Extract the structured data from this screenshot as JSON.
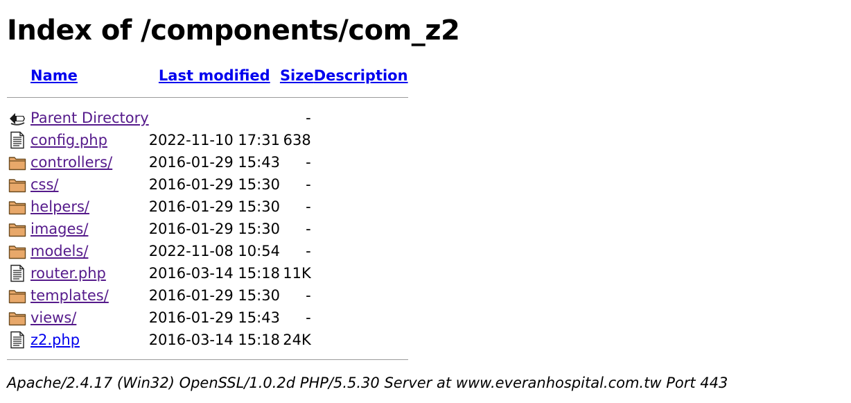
{
  "title": "Index of /components/com_z2",
  "headers": {
    "name": "Name",
    "last_modified": "Last modified",
    "size": "Size",
    "description": "Description"
  },
  "entries": [
    {
      "icon": "back-icon",
      "name": "Parent Directory",
      "date": "",
      "size": "-"
    },
    {
      "icon": "file-icon",
      "name": "config.php",
      "date": "2022-11-10 17:31",
      "size": "638"
    },
    {
      "icon": "folder-icon",
      "name": "controllers/",
      "date": "2016-01-29 15:43",
      "size": "-"
    },
    {
      "icon": "folder-icon",
      "name": "css/",
      "date": "2016-01-29 15:30",
      "size": "-"
    },
    {
      "icon": "folder-icon",
      "name": "helpers/",
      "date": "2016-01-29 15:30",
      "size": "-"
    },
    {
      "icon": "folder-icon",
      "name": "images/",
      "date": "2016-01-29 15:30",
      "size": "-"
    },
    {
      "icon": "folder-icon",
      "name": "models/",
      "date": "2022-11-08 10:54",
      "size": "-"
    },
    {
      "icon": "file-icon",
      "name": "router.php",
      "date": "2016-03-14 15:18",
      "size": "11K"
    },
    {
      "icon": "folder-icon",
      "name": "templates/",
      "date": "2016-01-29 15:30",
      "size": "-"
    },
    {
      "icon": "folder-icon",
      "name": "views/",
      "date": "2016-01-29 15:43",
      "size": "-"
    },
    {
      "icon": "file-icon",
      "name": "z2.php",
      "date": "2016-03-14 15:18",
      "size": "24K"
    }
  ],
  "footer": "Apache/2.4.17 (Win32) OpenSSL/1.0.2d PHP/5.5.30 Server at www.everanhospital.com.tw Port 443",
  "colors": {
    "link": "#0000ee",
    "visited_link": "#551a8b",
    "folder_fill": "#e8a86a",
    "folder_stroke": "#6b4a1e"
  }
}
